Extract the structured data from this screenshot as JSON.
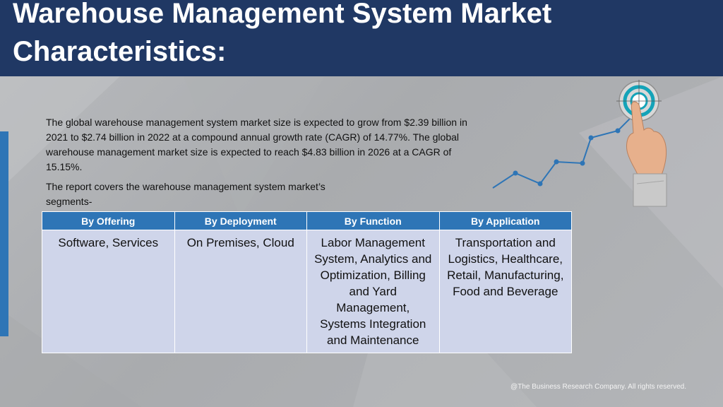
{
  "header": {
    "title": "Warehouse Management System Market Characteristics:"
  },
  "intro": {
    "paragraph": "The global warehouse management system market size is expected to grow from $2.39 billion in 2021 to $2.74 billion in 2022 at a compound annual growth rate (CAGR) of 14.77%. The global warehouse management market size is expected to reach $4.83 billion in 2026 at a CAGR of 15.15%.",
    "segments_note": "The report covers the warehouse management system market’s segments-"
  },
  "table": {
    "headers": [
      "By Offering",
      "By Deployment",
      "By Function",
      "By Application"
    ],
    "cells": [
      "Software, Services",
      "On Premises, Cloud",
      "Labor Management System, Analytics and Optimization, Billing and Yard Management, Systems Integration and Maintenance",
      "Transportation and Logistics, Healthcare, Retail, Manufacturing, Food and Beverage"
    ]
  },
  "footer": {
    "copyright": "@The Business Research Company. All rights reserved."
  },
  "colors": {
    "title_bar": "#203864",
    "header_cell": "#2e75b6",
    "body_cell": "#cfd5ea",
    "accent": "#2e75b6"
  },
  "icons": {
    "graphic": "target-growth-hand-icon"
  }
}
